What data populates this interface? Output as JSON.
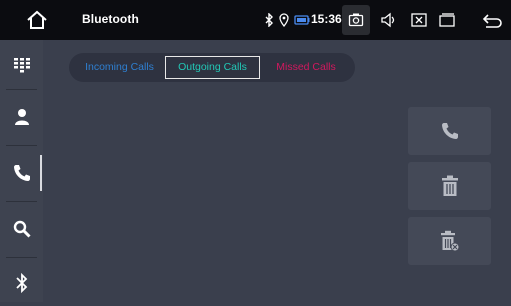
{
  "statusbar": {
    "title": "Bluetooth",
    "time": "15:36"
  },
  "icons": {
    "home": "home-icon",
    "bluetooth_status": "bluetooth-icon",
    "location": "location-pin-icon",
    "battery": "battery-icon",
    "screenshot": "camera-icon",
    "volume": "speaker-icon",
    "close": "close-box-icon",
    "window": "window-icon",
    "back": "back-arrow-icon"
  },
  "sidebar": {
    "items": [
      {
        "icon": "dialpad-icon"
      },
      {
        "icon": "contacts-icon"
      },
      {
        "icon": "phone-icon",
        "active": true
      },
      {
        "icon": "search-icon"
      },
      {
        "icon": "bluetooth-icon"
      }
    ]
  },
  "tabs": [
    {
      "label": "Incoming Calls",
      "color": "#2e7fd0"
    },
    {
      "label": "Outgoing Calls",
      "color": "#22c8b6",
      "selected": true
    },
    {
      "label": "Missed Calls",
      "color": "#d2185e"
    }
  ],
  "actions": [
    {
      "icon": "call-icon"
    },
    {
      "icon": "trash-icon"
    },
    {
      "icon": "trash-all-icon"
    }
  ],
  "colors": {
    "background": "#3a3f4d",
    "topbar": "#0b0c10",
    "accent": "#22c8b6"
  }
}
